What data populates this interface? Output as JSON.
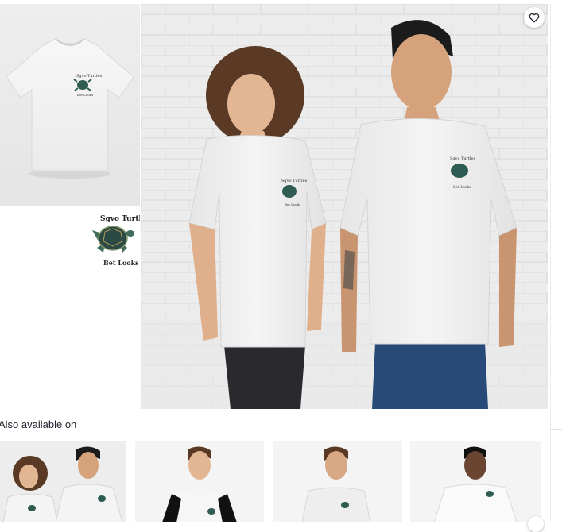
{
  "product": {
    "design_text_top": "Sgvo Turtles",
    "design_text_bottom": "Bet Looks"
  },
  "gallery": {
    "thumbnails": [
      {
        "name": "front-tee"
      },
      {
        "name": "design-closeup"
      }
    ]
  },
  "also_available": {
    "title": "Also available on",
    "items": [
      {
        "name": "essential-tee-couple"
      },
      {
        "name": "graphic-tee"
      },
      {
        "name": "long-fitted-tee"
      },
      {
        "name": "premium-tee"
      }
    ]
  },
  "icons": {
    "favorite": "heart-outline-icon"
  },
  "colors": {
    "tee": "#f2f2f2",
    "text": "#22202c",
    "turtle": "#2f5c52"
  }
}
